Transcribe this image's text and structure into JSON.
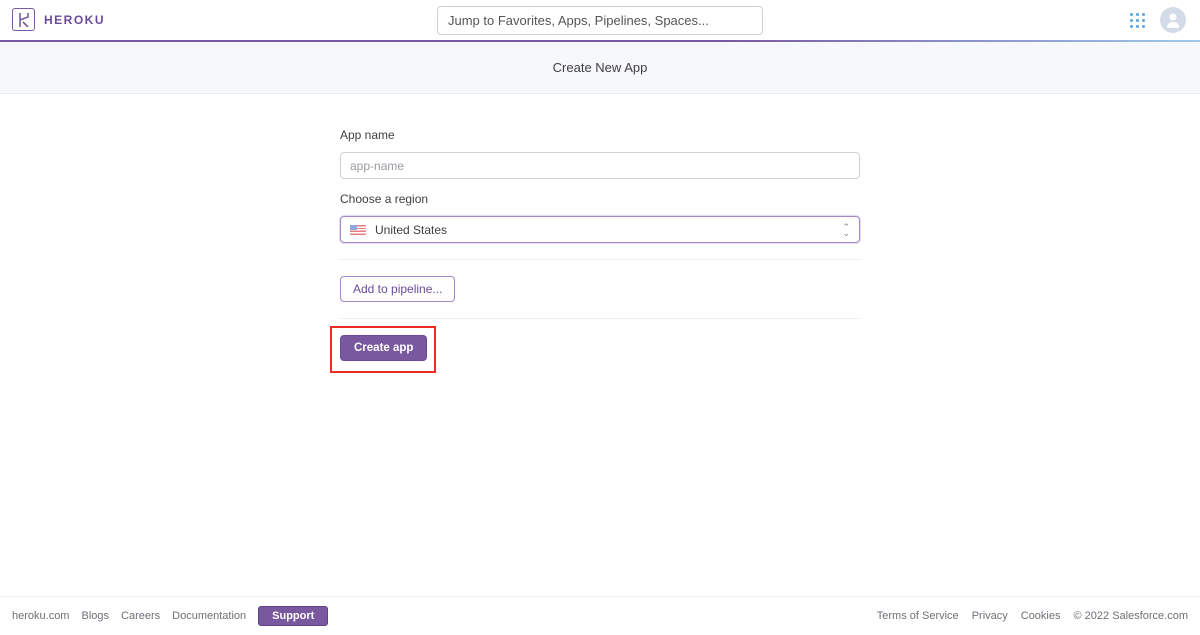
{
  "header": {
    "brand": "HEROKU",
    "search_placeholder": "Jump to Favorites, Apps, Pipelines, Spaces..."
  },
  "subheader": {
    "title": "Create New App"
  },
  "form": {
    "app_name_label": "App name",
    "app_name_placeholder": "app-name",
    "app_name_value": "",
    "region_label": "Choose a region",
    "region_value": "United States",
    "pipeline_button": "Add to pipeline...",
    "create_button": "Create app"
  },
  "footer": {
    "left": [
      "heroku.com",
      "Blogs",
      "Careers",
      "Documentation"
    ],
    "support": "Support",
    "right": [
      "Terms of Service",
      "Privacy",
      "Cookies",
      "© 2022 Salesforce.com"
    ]
  },
  "colors": {
    "brand": "#79589f",
    "highlight": "#ec2b24"
  }
}
